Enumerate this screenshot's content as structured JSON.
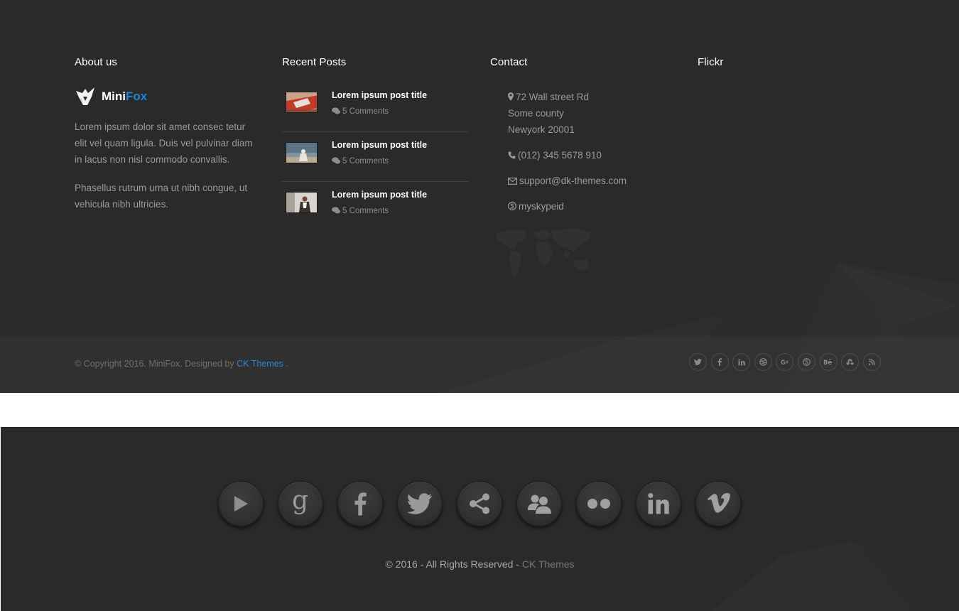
{
  "about": {
    "heading": "About us",
    "logo_part1": "Mini",
    "logo_part2": "Fox",
    "paragraph1": "Lorem ipsum dolor sit amet consec tetur elit vel quam ligula. Duis vel pulvinar diam in lacus non nisl commodo convallis.",
    "paragraph2": "Phasellus rutrum urna ut nibh congue, ut vehicula nibh ultricies."
  },
  "recent_posts": {
    "heading": "Recent Posts",
    "items": [
      {
        "title": "Lorem ipsum post title",
        "comments": "5 Comments"
      },
      {
        "title": "Lorem ipsum post title",
        "comments": "5 Comments"
      },
      {
        "title": "Lorem ipsum post title",
        "comments": "5 Comments"
      }
    ]
  },
  "contact": {
    "heading": "Contact",
    "address_line1": "72 Wall street Rd",
    "address_line2": "Some county",
    "address_line3": "Newyork 20001",
    "phone": "(012) 345 5678 910",
    "email": "support@dk-themes.com",
    "skype": "myskypeid"
  },
  "flickr": {
    "heading": "Flickr"
  },
  "footer_bottom": {
    "copyright_prefix": "© Copyright 2016. MiniFox. Designed by ",
    "designer_link": "CK Themes",
    "copyright_suffix": " .",
    "social_icons": [
      "twitter-icon",
      "facebook-icon",
      "linkedin-icon",
      "dribbble-icon",
      "google-plus-icon",
      "skype-icon",
      "behance-icon",
      "stumbleupon-icon",
      "rss-icon"
    ]
  },
  "footer2": {
    "social_icons": [
      "youtube-play-icon",
      "google-icon",
      "facebook-icon",
      "twitter-icon",
      "share-icon",
      "users-icon",
      "flickr-icon",
      "linkedin-icon",
      "vimeo-icon"
    ],
    "copyright_text": "© 2016 - All Rights Reserved - ",
    "copyright_link": "CK Themes"
  },
  "colors": {
    "background": "#2a2a2a",
    "brand_accent": "#1b84d8",
    "link": "#2b86d6",
    "muted_text": "#9a9a9a"
  }
}
